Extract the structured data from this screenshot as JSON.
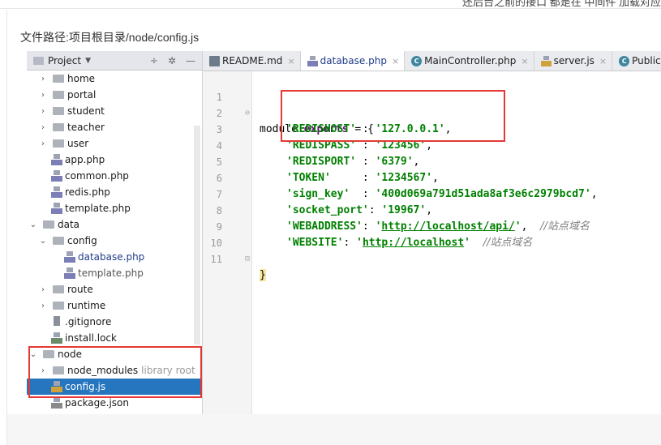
{
  "top_strip_text": "还后台之前的接口 都是在 中间件 加载对应",
  "caption": "文件路径:项目根目录/node/config.js",
  "project_panel": {
    "header_label": "Project",
    "tools": [
      "÷",
      "✲",
      "—"
    ],
    "tree": [
      {
        "label": "home",
        "kind": "folder",
        "arrow": ">"
      },
      {
        "label": "portal",
        "kind": "folder",
        "arrow": ">"
      },
      {
        "label": "student",
        "kind": "folder",
        "arrow": ">"
      },
      {
        "label": "teacher",
        "kind": "folder",
        "arrow": ">"
      },
      {
        "label": "user",
        "kind": "folder",
        "arrow": ">"
      },
      {
        "label": "app.php",
        "kind": "php"
      },
      {
        "label": "common.php",
        "kind": "php"
      },
      {
        "label": "redis.php",
        "kind": "php"
      },
      {
        "label": "template.php",
        "kind": "php"
      },
      {
        "label": "data",
        "kind": "folder",
        "arrow": "v"
      },
      {
        "label": "config",
        "kind": "folder",
        "arrow": "v"
      },
      {
        "label": "database.php",
        "kind": "php"
      },
      {
        "label": "template.php",
        "kind": "php"
      },
      {
        "label": "route",
        "kind": "folder",
        "arrow": ">"
      },
      {
        "label": "runtime",
        "kind": "folder",
        "arrow": ">"
      },
      {
        "label": ".gitignore",
        "kind": "git"
      },
      {
        "label": "install.lock",
        "kind": "lock"
      },
      {
        "label": "node",
        "kind": "folder",
        "arrow": "v"
      },
      {
        "label": "node_modules",
        "kind": "folder",
        "arrow": ">",
        "note": "library root"
      },
      {
        "label": "config.js",
        "kind": "js",
        "selected": true
      },
      {
        "label": "package.json",
        "kind": "json"
      }
    ]
  },
  "tabs": [
    {
      "label": "README.md",
      "icon": "markdown-file-icon",
      "close": "×"
    },
    {
      "label": "database.php",
      "icon": "php-file-icon",
      "close": "×"
    },
    {
      "label": "MainController.php",
      "icon": "class-icon",
      "close": "×"
    },
    {
      "label": "server.js",
      "icon": "js-file-icon",
      "close": "×"
    },
    {
      "label": "PublicCon",
      "icon": "class-icon",
      "close": ""
    }
  ],
  "code": {
    "line_numbers": [
      "1",
      "2",
      "3",
      "4",
      "5",
      "6",
      "7",
      "8",
      "9",
      "10",
      "11"
    ],
    "l1_a": "module.",
    "l1_b": "exports",
    "l1_c": " = {",
    "l2_key": "'REDISHOST'",
    "l2_sep": " : ",
    "l2_val": "'127.0.0.1'",
    "l2_end": ",",
    "l3_key": "'REDISPASS'",
    "l3_sep": " : ",
    "l3_val": "'123456'",
    "l3_end": ",",
    "l4_key": "'REDISPORT'",
    "l4_sep": " : ",
    "l4_val": "'6379'",
    "l4_end": ",",
    "l5_key": "'TOKEN'",
    "l5_sep": "     : ",
    "l5_val": "'1234567'",
    "l5_end": ",",
    "l6_key": "'sign_key'",
    "l6_sep": "  : ",
    "l6_val": "'400d069a791d51ada8af3e6c2979bcd7'",
    "l6_end": ",",
    "l7_key": "'socket_port'",
    "l7_sep": ": ",
    "l7_val": "'19967'",
    "l7_end": ",",
    "l8_key": "'WEBADDRESS'",
    "l8_sep": ": ",
    "l8_q1": "'",
    "l8_url": "http://localhost/api/",
    "l8_q2": "'",
    "l8_end": ",  ",
    "l8_cmt": "//站点域名",
    "l9_key": "'WEBSITE'",
    "l9_sep": ": ",
    "l9_q1": "'",
    "l9_url": "http://localhost",
    "l9_q2": "'",
    "l9_end": "  ",
    "l9_cmt": "//站点域名",
    "l10": "}"
  }
}
